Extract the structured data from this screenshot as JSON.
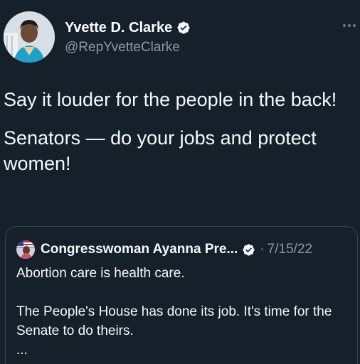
{
  "author": {
    "display_name": "Yvette D. Clarke",
    "handle": "@RepYvetteClarke",
    "verified": true
  },
  "tweet": {
    "paragraphs": [
      "Say it louder for the people in the back!",
      "Senators — do your jobs and protect women!"
    ]
  },
  "quoted_tweet": {
    "display_name": "Congresswoman Ayanna Pre...",
    "separator": "·",
    "date": "7/15/22",
    "paragraph_1": "Abortion care is health care.",
    "paragraph_2": "The People's House has done its job. It's time for the Senate to do theirs.",
    "truncation": "..."
  },
  "colors": {
    "background": "#15202b",
    "text_primary": "#f7f9f9",
    "text_secondary": "#8b98a5",
    "border": "#38444d"
  },
  "icons": {
    "verified": "verified-badge-icon",
    "more": "more-options-icon"
  }
}
